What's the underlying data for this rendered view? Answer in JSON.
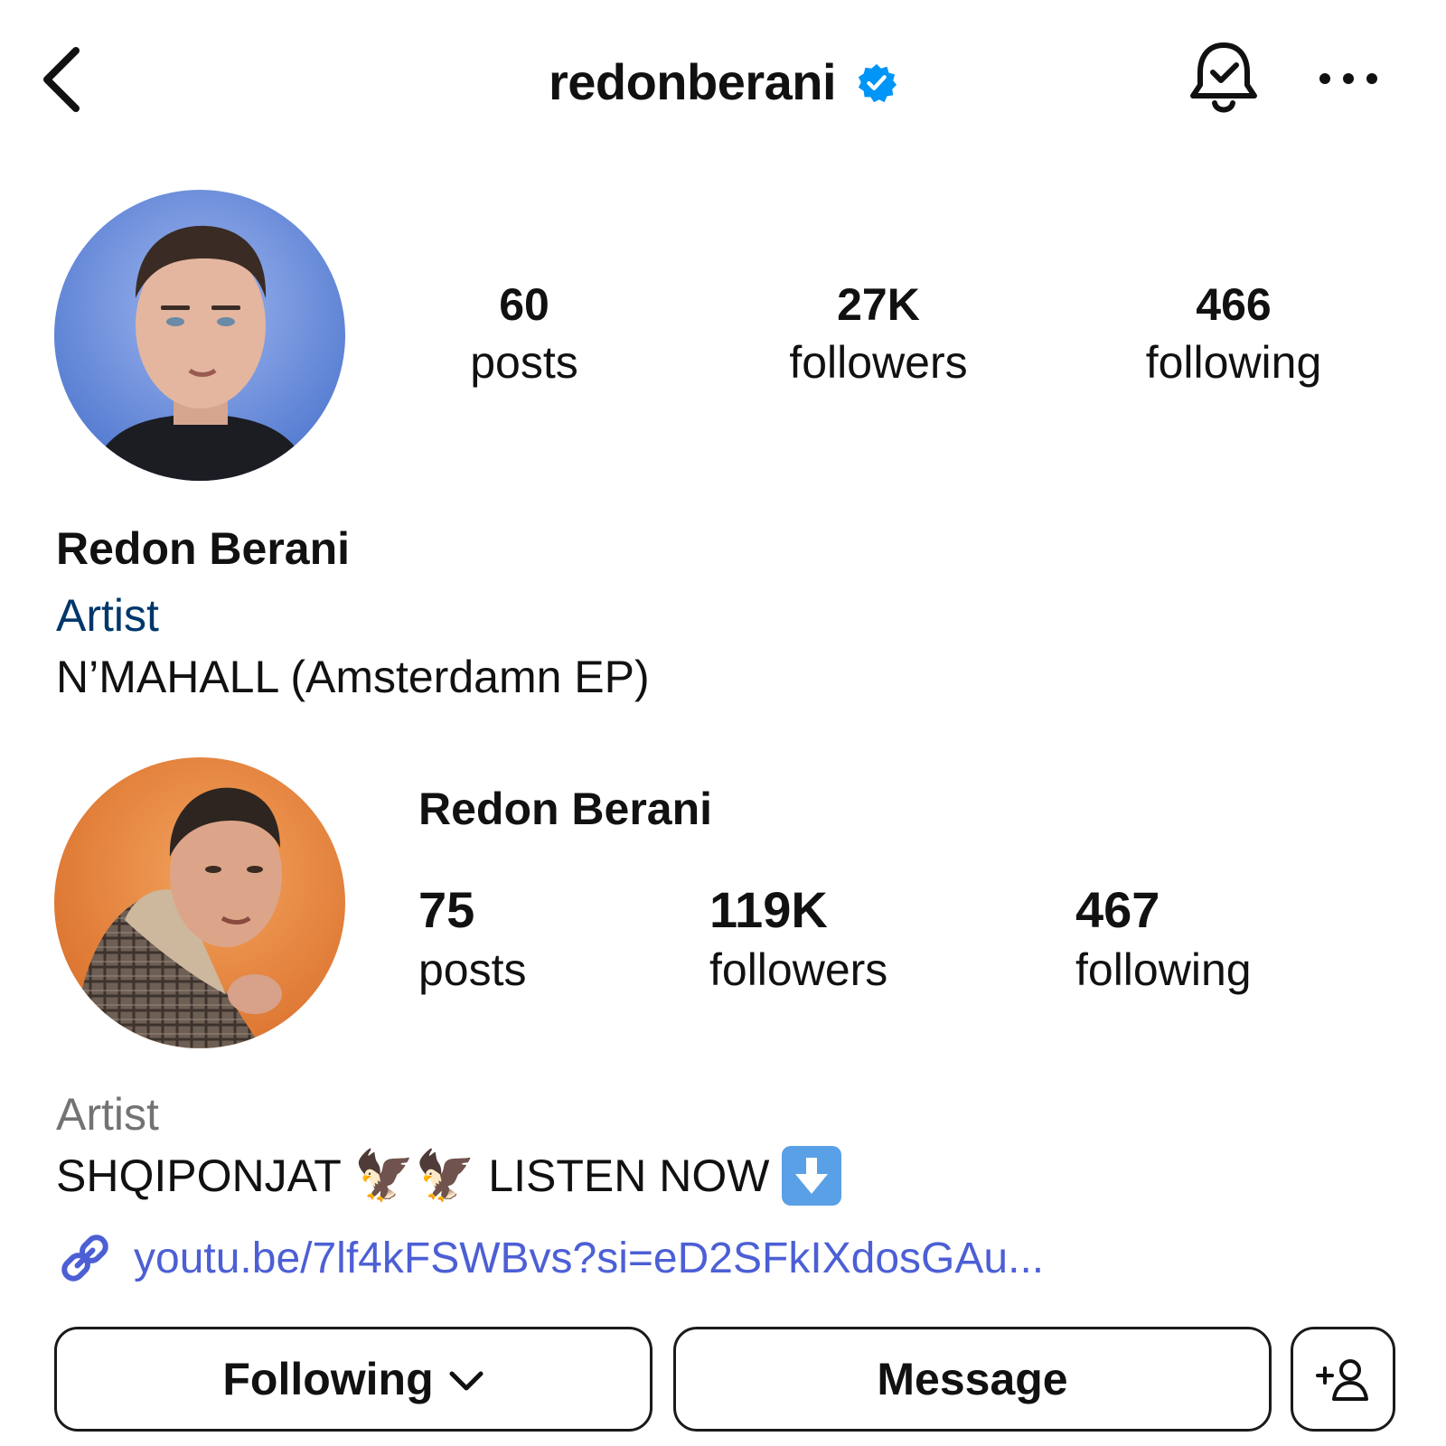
{
  "header": {
    "username": "redonberani",
    "verified": true,
    "icons": {
      "back": "chevron-left-icon",
      "verified": "verified-badge-icon",
      "notifications": "bell-check-icon",
      "more": "more-horizontal-icon"
    }
  },
  "profile": {
    "stats": [
      {
        "value": "60",
        "label": "posts"
      },
      {
        "value": "27K",
        "label": "followers"
      },
      {
        "value": "466",
        "label": "following"
      }
    ],
    "name": "Redon Berani",
    "category": "Artist",
    "bio": "N’MAHALL (Amsterdamn EP)"
  },
  "embedded_profile": {
    "name": "Redon Berani",
    "stats": [
      {
        "value": "75",
        "label": "posts"
      },
      {
        "value": "119K",
        "label": "followers"
      },
      {
        "value": "467",
        "label": "following"
      }
    ],
    "category": "Artist",
    "bio_text_1": "SHQIPONJAT",
    "bio_emoji": "🦅🦅",
    "bio_text_2": "LISTEN NOW",
    "bio_icon": "down-arrow-emoji-icon",
    "link": "youtu.be/7lf4kFSWBvs?si=eD2SFkIXdosGAu..."
  },
  "actions": {
    "following_label": "Following",
    "message_label": "Message",
    "add_user_icon": "add-user-icon"
  },
  "colors": {
    "category_link": "#00376b",
    "category_gray": "#737373",
    "link": "#4c5fd5",
    "verified": "#0095f6"
  }
}
